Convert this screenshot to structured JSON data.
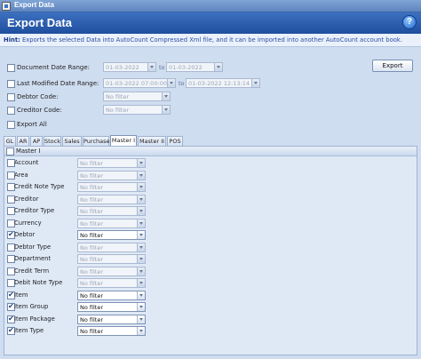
{
  "window": {
    "title": "Export Data"
  },
  "header": {
    "title": "Export Data",
    "help_glyph": "?"
  },
  "hint": {
    "label": "Hint:",
    "text": " Exports the selected Data into AutoCount Compressed Xml file, and it can be imported into another AutoCount account book."
  },
  "filters": {
    "document_date": {
      "label": "Document Date Range:",
      "from": "01-03-2022",
      "to_label": "to",
      "to": "01-03-2022",
      "checked": false
    },
    "last_modified": {
      "label": "Last Modified Date Range:",
      "from": "01-03-2022 07:00:00",
      "to_label": "to",
      "to": "01-03-2022 12:13:14",
      "checked": false
    },
    "debtor_code": {
      "label": "Debtor Code:",
      "value": "No filter",
      "checked": false
    },
    "creditor_code": {
      "label": "Creditor Code:",
      "value": "No filter",
      "checked": false
    },
    "export_all": {
      "label": "Export All",
      "checked": false
    }
  },
  "export_button": {
    "label": "Export"
  },
  "tabs": [
    "GL",
    "AR",
    "AP",
    "Stock",
    "Sales",
    "Purchase",
    "Master I",
    "Master II",
    "POS"
  ],
  "active_tab": "Master I",
  "group": {
    "label": "Master I",
    "checked": false
  },
  "rows": [
    {
      "label": "Account",
      "value": "No filter",
      "checked": false
    },
    {
      "label": "Area",
      "value": "No filter",
      "checked": false
    },
    {
      "label": "Credit Note Type",
      "value": "No filter",
      "checked": false
    },
    {
      "label": "Creditor",
      "value": "No filter",
      "checked": false
    },
    {
      "label": "Creditor Type",
      "value": "No filter",
      "checked": false
    },
    {
      "label": "Currency",
      "value": "No filter",
      "checked": false
    },
    {
      "label": "Debtor",
      "value": "No filter",
      "checked": true
    },
    {
      "label": "Debtor Type",
      "value": "No filter",
      "checked": false
    },
    {
      "label": "Department",
      "value": "No filter",
      "checked": false
    },
    {
      "label": "Credit Term",
      "value": "No filter",
      "checked": false
    },
    {
      "label": "Debit Note Type",
      "value": "No filter",
      "checked": false
    },
    {
      "label": "Item",
      "value": "No filter",
      "checked": true
    },
    {
      "label": "Item Group",
      "value": "No filter",
      "checked": true
    },
    {
      "label": "Item Package",
      "value": "No filter",
      "checked": true
    },
    {
      "label": "Item Type",
      "value": "No filter",
      "checked": true
    }
  ],
  "colors": {
    "header": "#1f4f9e",
    "titlebar": "#5d84bf",
    "panel": "#dfe9f6",
    "hint_text": "#2a4ea3"
  }
}
